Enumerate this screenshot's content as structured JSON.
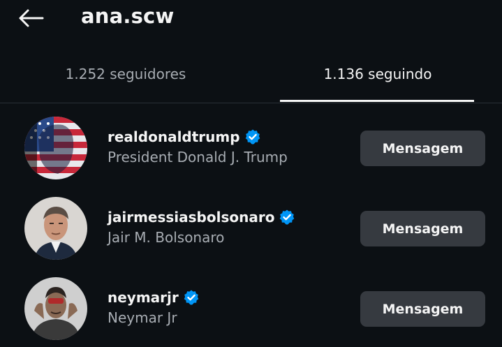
{
  "header": {
    "back_icon": "arrow-left-icon",
    "username": "ana.scw"
  },
  "tabs": [
    {
      "label": "1.252 seguidores",
      "active": false
    },
    {
      "label": "1.136 seguindo",
      "active": true
    }
  ],
  "accounts": [
    {
      "handle": "realdonaldtrump",
      "full_name": "President Donald J. Trump",
      "verified": true,
      "button_label": "Mensagem"
    },
    {
      "handle": "jairmessiasbolsonaro",
      "full_name": "Jair M. Bolsonaro",
      "verified": true,
      "button_label": "Mensagem"
    },
    {
      "handle": "neymarjr",
      "full_name": "Neymar Jr",
      "verified": true,
      "button_label": "Mensagem"
    }
  ],
  "colors": {
    "background": "#0c1014",
    "secondary_text": "#a8adb3",
    "button_bg": "#363a40",
    "verified_blue": "#0095f6"
  }
}
